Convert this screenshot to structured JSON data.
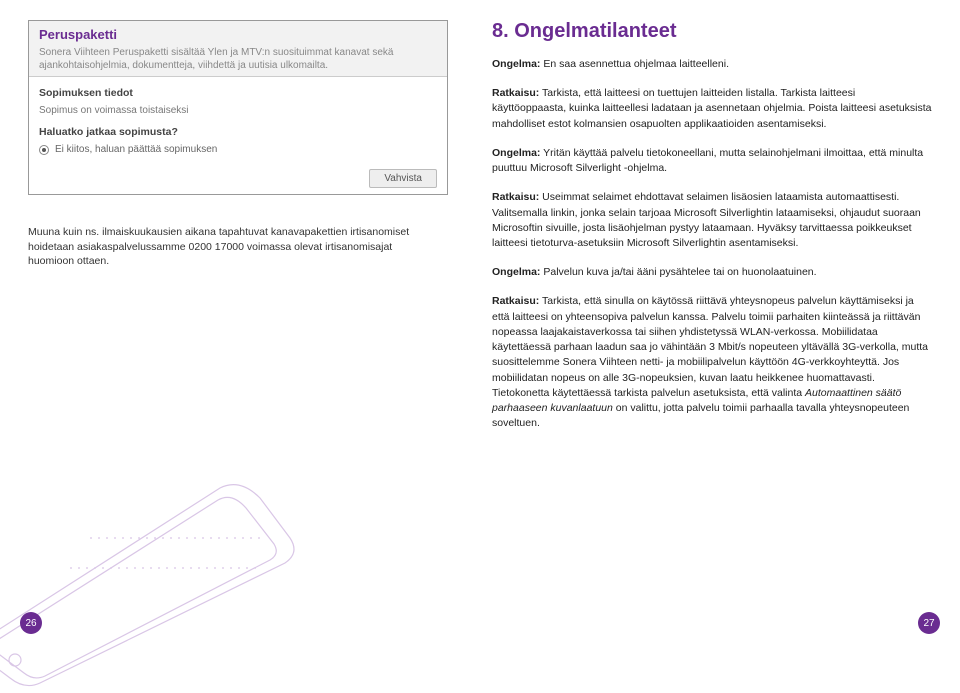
{
  "left": {
    "screenshot": {
      "title": "Peruspaketti",
      "desc": "Sonera Viihteen Peruspaketti sisältää Ylen ja MTV:n suosituimmat kanavat sekä ajankohtaisohjelmia, dokumentteja, viihdettä ja uutisia ulkomailta.",
      "section1_label": "Sopimuksen tiedot",
      "section1_text": "Sopimus on voimassa toistaiseksi",
      "section2_label": "Haluatko jatkaa sopimusta?",
      "radio_text": "Ei kiitos, haluan päättää sopimuksen",
      "button": "Vahvista"
    },
    "caption": "Muuna kuin ns. ilmaiskuukausien aikana tapahtuvat kanavapakettien irtisanomiset hoidetaan asiakaspalvelussamme 0200 17000 voimassa olevat irtisanomisajat huomioon ottaen.",
    "page_num": "26"
  },
  "right": {
    "heading": "8. Ongelmatilanteet",
    "q1_label": "Ongelma:",
    "q1_text": " En saa asennettua ohjelmaa laitteelleni.",
    "a1_label": "Ratkaisu:",
    "a1_text": " Tarkista, että laitteesi on tuettujen laitteiden listalla. Tarkista laitteesi käyttöoppaasta, kuinka laitteellesi ladataan ja asennetaan ohjelmia. Poista laitteesi asetuksista mahdolliset estot kolmansien osapuolten applikaatioiden asentamiseksi.",
    "q2_label": "Ongelma:",
    "q2_text": " Yritän käyttää palvelu tietokoneellani, mutta selainohjelmani ilmoittaa, että minulta puuttuu Microsoft Silverlight -ohjelma.",
    "a2_label": "Ratkaisu:",
    "a2_text": " Useimmat selaimet ehdottavat selaimen lisäosien lataamista automaattisesti. Valitsemalla linkin, jonka selain tarjoaa Microsoft Silverlightin lataamiseksi, ohjaudut suoraan Microsoftin sivuille, josta lisäohjelman pystyy lataamaan. Hyväksy tarvittaessa poikkeukset laitteesi tietoturva-asetuksiin Microsoft Silverlightin asentamiseksi.",
    "q3_label": "Ongelma:",
    "q3_text": " Palvelun kuva ja/tai ääni pysähtelee tai on huonolaatuinen.",
    "a3_label": "Ratkaisu:",
    "a3_text_part1": " Tarkista, että sinulla on käytössä riittävä yhteysnopeus palvelun käyttämiseksi ja että laitteesi on yhteensopiva palvelun kanssa. Palvelu toimii parhaiten kiinteässä ja riittävän nopeassa laajakaistaverkossa tai siihen yhdistetyssä WLAN-verkossa. Mobiilidataa käytettäessä parhaan laadun saa jo vähintään 3 Mbit/s nopeuteen yltävällä 3G-verkolla, mutta suosittelemme Sonera Viihteen netti- ja mobiilipalvelun käyttöön 4G-verkkoyhteyttä. Jos mobiilidatan nopeus on alle 3G-nopeuksien, kuvan laatu heikkenee huomattavasti. Tietokonetta käytettäessä tarkista palvelun asetuksista, että valinta ",
    "a3_italic": "Automaattinen säätö parhaaseen kuvanlaatuun",
    "a3_text_part2": " on valittu, jotta palvelu toimii parhaalla tavalla yhteysnopeuteen soveltuen.",
    "page_num": "27"
  }
}
